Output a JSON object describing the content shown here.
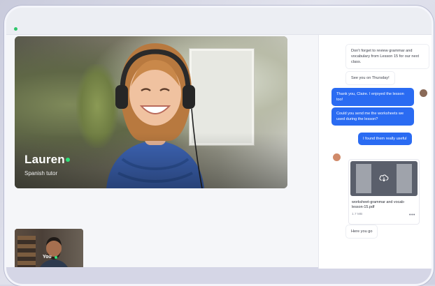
{
  "video_call": {
    "participant": {
      "name": "Lauren",
      "role": "Spanish tutor"
    },
    "self_view": {
      "label": "You"
    }
  },
  "chat": {
    "messages": [
      {
        "text": "Don't forget to review grammar and vocabulary from Lesson 15 for our next class.",
        "direction": "incoming"
      },
      {
        "text": "See you on Thursday!",
        "direction": "incoming"
      },
      {
        "text": "Thank you, Claire. I enjoyed the lesson too!",
        "direction": "outgoing"
      },
      {
        "text": "Could you send me the worksheets we used during the lesson?",
        "direction": "outgoing"
      },
      {
        "text": "I found them really useful",
        "direction": "outgoing"
      }
    ],
    "attachment": {
      "file_name": "worksheet-grammar and vocab-lesson-15.pdf",
      "file_size": "1.7 MB",
      "icon": "cloud-download-icon"
    },
    "last_message": {
      "text": "Here you go",
      "direction": "incoming"
    }
  },
  "colors": {
    "outgoing_bubble": "#2a6bf2",
    "online_status": "#2fe07a"
  }
}
